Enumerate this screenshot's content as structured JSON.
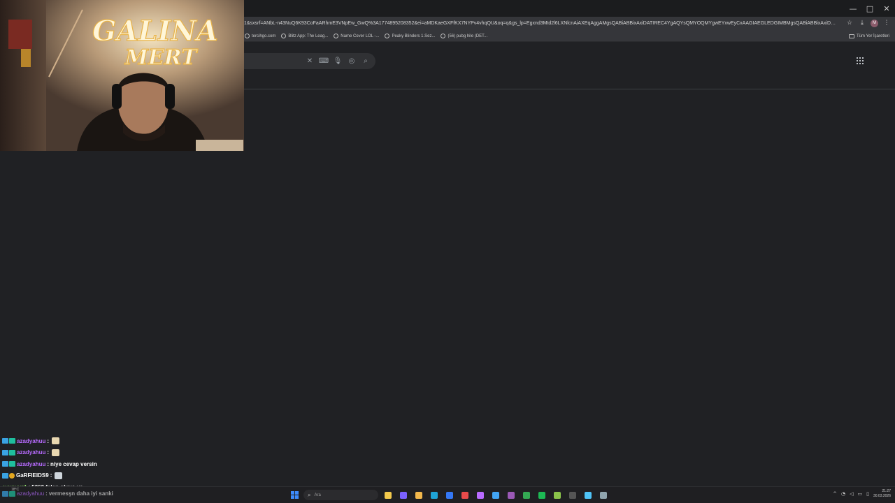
{
  "browser": {
    "url": "1&sxsrf=ANbL-n43NuQ6K93CoFaARhmE3VNpEw_GwQ%3A1774895208352&ei=aMDKaeGXFfKX7NYPv4vhqQU&oq=q&gs_lp=Egxnd3Mtd2l6LXNlcnAiAXEqAggAMgsQABiABBixAxiDATIREC4YgAQYsQMYOQMYgwEYxwEyCxAAGIAEGLEDGIMBMgsQABiABBixAxiDATIEEAAYgAQY...",
    "window_controls": [
      "—",
      "□",
      "✕"
    ],
    "toolbar_icons": [
      "download-icon",
      "profile-avatar",
      "more-icon"
    ],
    "profile_initial": "M",
    "bookmarks": [
      {
        "label": "tercihgo.com"
      },
      {
        "label": "Blitz App: The Leag..."
      },
      {
        "label": "Name Cover LOL -..."
      },
      {
        "label": "Peaky Blinders 1.Sez..."
      },
      {
        "label": "(56) pubg hile (DET..."
      }
    ],
    "all_bookmarks_label": "Tüm Yer İşaretleri"
  },
  "search": {
    "icons": [
      "clear-icon",
      "keyboard-icon",
      "mic-icon",
      "lens-icon",
      "search-icon"
    ]
  },
  "webcam": {
    "neon_sign_line1": "GALINA",
    "neon_sign_line2": "MERT"
  },
  "chat": {
    "messages": [
      {
        "user": "azadyahuu",
        "sep": " :",
        "msg": "",
        "emote": true,
        "badges": [
          "prime",
          "sub"
        ],
        "user_color": "purple"
      },
      {
        "user": "azadyahuu",
        "sep": " :",
        "msg": "",
        "emote": true,
        "badges": [
          "prime",
          "sub"
        ],
        "user_color": "purple"
      },
      {
        "user": "azadyahuu",
        "sep": " :",
        "msg": " niye cevap versin",
        "emote": false,
        "badges": [
          "prime",
          "sub"
        ],
        "user_color": "purple"
      },
      {
        "user": "GaRFIEIDS9",
        "sep": " :",
        "msg": "",
        "emote": true,
        "badges": [
          "prime",
          "gold"
        ],
        "user_color": "white"
      },
      {
        "user": "eyypyyz1",
        "sep": " :",
        "msg": " 5060 falan oluyo ya",
        "emote": false,
        "badges": [],
        "user_color": "green"
      }
    ],
    "partial": {
      "user": "azadyahuu",
      "sep": " :",
      "msg": " vermesşn daha iyi sanki"
    }
  },
  "taskbar": {
    "weather": "18°C",
    "search_placeholder": "Ara",
    "apps": [
      {
        "name": "file-explorer",
        "color": "#f2c94c"
      },
      {
        "name": "browser-1",
        "color": "#7b61ff"
      },
      {
        "name": "folder",
        "color": "#f2b84c"
      },
      {
        "name": "edge",
        "color": "#1fa3d6"
      },
      {
        "name": "store",
        "color": "#3478f6"
      },
      {
        "name": "yandex",
        "color": "#e94b4b"
      },
      {
        "name": "discord-like",
        "color": "#b86bff"
      },
      {
        "name": "messenger",
        "color": "#42a5f5"
      },
      {
        "name": "app-purple",
        "color": "#9b59b6"
      },
      {
        "name": "chrome",
        "color": "#34a853"
      },
      {
        "name": "app-green",
        "color": "#1db954"
      },
      {
        "name": "app-lime",
        "color": "#8bc34a"
      },
      {
        "name": "terminal",
        "color": "#555555"
      },
      {
        "name": "app-blue",
        "color": "#4fc3f7"
      },
      {
        "name": "steam",
        "color": "#90a4ae"
      }
    ],
    "clock_time": "21:27",
    "clock_date": "30.03.2026"
  }
}
